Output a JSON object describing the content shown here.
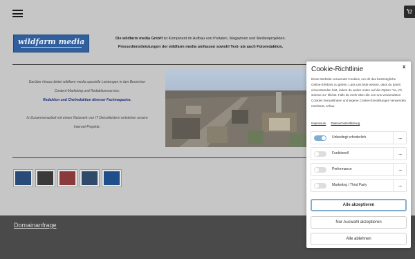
{
  "header": {
    "menu_icon": "hamburger-icon",
    "cart_icon": "cart-icon"
  },
  "logo": {
    "text": "wildfarm media"
  },
  "intro": {
    "line1_bold": "Die wildfarm media GmbH",
    "line1_rest": " ist Kompetent im Aufbau von Portalen, Magazinen und Medienprojekten.",
    "line2": "Pressedienstleistungen der wildfarm media umfassen sowohl Text- als auch Fotoredaktion."
  },
  "content": {
    "p1_l1": "Darüber hinaus bietet wildfarm media spezielle Leistungen in den Bereichen",
    "p1_l2": "Content-Marketing und Redaktionsservice.",
    "p1_hl": "Redaktion und Chefredaktion diverser Fachmagazine.",
    "p2_l1": "In Zusammenarbeit mit einem Netzwerk von IT Dienstleistern entstehen unsere",
    "p2_l2": "Internet-Projekte."
  },
  "thumbnails": [
    {
      "name": "thumb-1",
      "color": "#2a4a7a"
    },
    {
      "name": "thumb-2",
      "color": "#3a3a3a"
    },
    {
      "name": "thumb-3",
      "color": "#8a3a3a"
    },
    {
      "name": "thumb-4",
      "color": "#304a6a"
    },
    {
      "name": "thumb-5",
      "color": "#1f4f8a"
    }
  ],
  "footer": {
    "link": "Domainanfrage"
  },
  "cookie": {
    "title": "Cookie-Richtlinie",
    "close": "x",
    "description": "Diese Website verwendet Cookies, um dir das bestmögliche Online-Erlebnis zu geben. Lass uns bitte wissen, dass du damit einverstanden bist, indem du weiter unten auf die Option \"Ja, ich stimme zu\" klickst. Falls du mehr über die von uns verwendeten Cookies herausfinden und eigene Cookie-Einstellungen verwenden möchtest, schau",
    "link_impressum": "Impressum",
    "link_privacy": "Datenschutzerklärung",
    "categories": [
      {
        "label": "Unbedingt erforderlich",
        "on": true
      },
      {
        "label": "Funktionell",
        "on": false
      },
      {
        "label": "Performance",
        "on": false
      },
      {
        "label": "Marketing / Third Party",
        "on": false
      }
    ],
    "arrow": "→",
    "btn_accept_all": "Alle akzeptieren",
    "btn_accept_selection": "Nur Auswahl akzeptieren",
    "btn_reject_all": "Alle ablehnen",
    "accent": "#7faed0"
  }
}
